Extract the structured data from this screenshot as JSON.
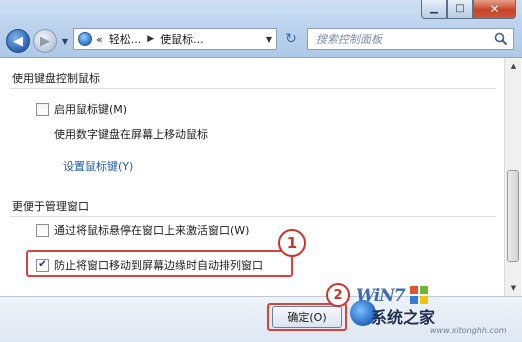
{
  "window": {
    "minimize_glyph": "▁",
    "maximize_glyph": "□",
    "close_glyph": "✕"
  },
  "nav": {
    "back_glyph": "◀",
    "forward_glyph": "▶",
    "dropdown_glyph": "▼"
  },
  "address": {
    "prefix": "«",
    "crumb1": "轻松...",
    "separator": "▶",
    "crumb2": "使鼠标...",
    "dropdown_glyph": "▼"
  },
  "refresh_glyph": "↻",
  "search": {
    "placeholder": "搜索控制面板"
  },
  "sections": [
    {
      "title": "使用键盘控制鼠标",
      "checkbox_label": "启用鼠标键(M)",
      "checked": false,
      "description": "使用数字键盘在屏幕上移动鼠标",
      "link": "设置鼠标键(Y)"
    },
    {
      "title": "更便于管理窗口",
      "option1_label": "通过将鼠标悬停在窗口上来激活窗口(W)",
      "option1_checked": false,
      "option2_label": "防止将窗口移动到屏幕边缘时自动排列窗口",
      "option2_checked": true
    }
  ],
  "checkmark_glyph": "✔",
  "annotations": {
    "step1": "1",
    "step2": "2"
  },
  "buttons": {
    "ok": "确定(O)"
  },
  "watermark": {
    "logo": "WiN7",
    "text": "系统之家",
    "url": "www.xitonghh.com"
  },
  "colors": {
    "annotation_red": "#d6443a",
    "link_blue": "#1e5da8",
    "chrome_blue": "#bcd3ee"
  }
}
